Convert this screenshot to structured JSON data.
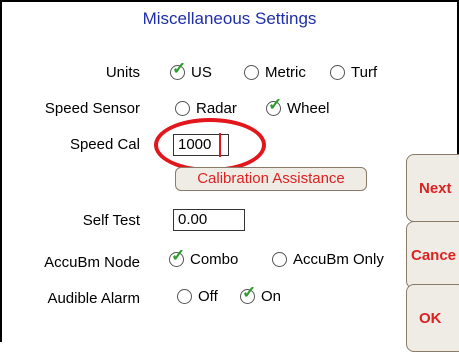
{
  "title": "Miscellaneous Settings",
  "units": {
    "label": "Units",
    "options": [
      {
        "label": "US",
        "checked": true
      },
      {
        "label": "Metric",
        "checked": false
      },
      {
        "label": "Turf",
        "checked": false
      }
    ]
  },
  "speed_sensor": {
    "label": "Speed Sensor",
    "options": [
      {
        "label": "Radar",
        "checked": false
      },
      {
        "label": "Wheel",
        "checked": true
      }
    ]
  },
  "speed_cal": {
    "label": "Speed Cal",
    "value": "1000"
  },
  "calibration_button": "Calibration Assistance",
  "self_test": {
    "label": "Self Test",
    "value": "0.00"
  },
  "accubm_node": {
    "label": "AccuBm Node",
    "options": [
      {
        "label": "Combo",
        "checked": true
      },
      {
        "label": "AccuBm Only",
        "checked": false
      }
    ]
  },
  "audible_alarm": {
    "label": "Audible Alarm",
    "options": [
      {
        "label": "Off",
        "checked": false
      },
      {
        "label": "On",
        "checked": true
      }
    ]
  },
  "side_buttons": {
    "next": "Next",
    "cancel": "Cance",
    "ok": "OK"
  },
  "colors": {
    "title": "#1f2fa8",
    "button_text": "#dd2222",
    "highlight": "#e3161b",
    "check": "#2c9e2c"
  }
}
